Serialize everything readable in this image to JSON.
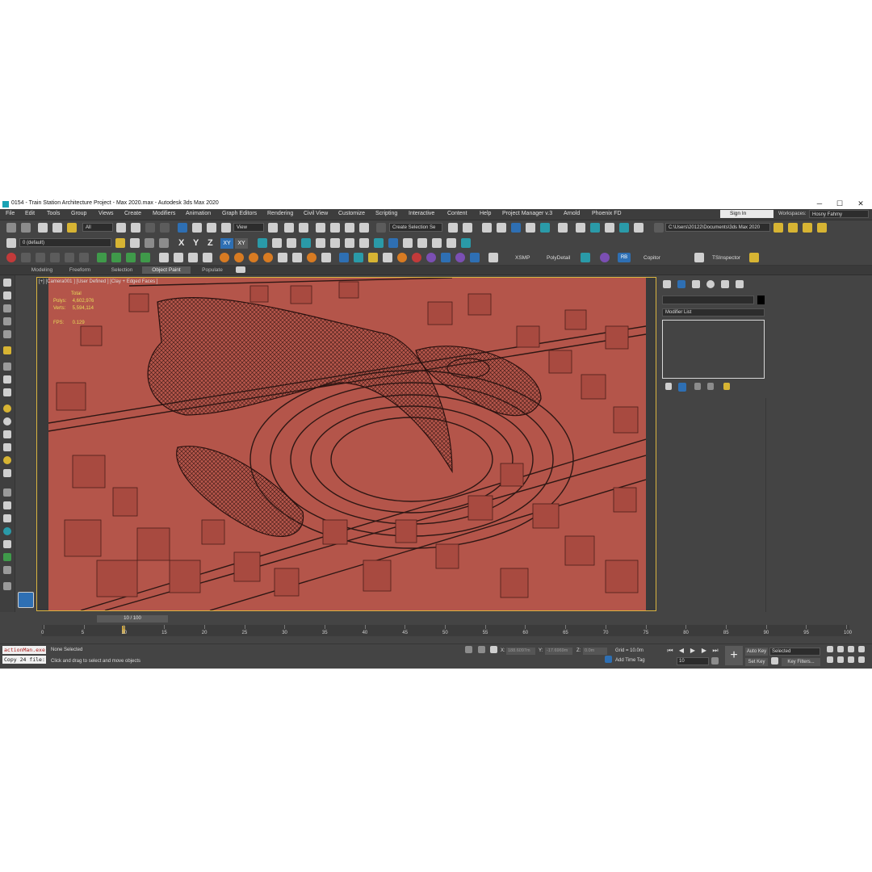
{
  "window": {
    "title": "0154 - Train Station Architecture Project - Max 2020.max - Autodesk 3ds Max 2020",
    "minimize": "─",
    "maximize": "☐",
    "close": "✕"
  },
  "menu": [
    "File",
    "Edit",
    "Tools",
    "Group",
    "Views",
    "Create",
    "Modifiers",
    "Animation",
    "Graph Editors",
    "Rendering",
    "Civil View",
    "Customize",
    "Scripting",
    "Interactive",
    "Content",
    "Help",
    "Project Manager v.3",
    "Arnold",
    "Phoenix FD"
  ],
  "account": {
    "sign_in": "Sign In",
    "workspaces_label": "Workspaces:",
    "workspace": "Hosny Fahmy"
  },
  "toolbar1": {
    "filter": "All",
    "ref_coord": "View",
    "selection_set": "Create Selection Se",
    "project_path": "C:\\Users\\20122\\Documents\\3ds Max 2020"
  },
  "toolbar2": {
    "layer": "0 (default)",
    "axis_x": "X",
    "axis_y": "Y",
    "axis_z": "Z",
    "axis_xy": "XY",
    "axis_xy2": "XY"
  },
  "toolbar3": {
    "xsmp": "XSMP",
    "polydetail": "PolyDetail",
    "rb": "RB",
    "copitor": "Copitor",
    "tsinspector": "TSInspector"
  },
  "ribbon_tabs": [
    "Modeling",
    "Freeform",
    "Selection",
    "Object Paint",
    "Populate"
  ],
  "viewport": {
    "label": "[+] [Camera001 ] [User Defined ] [Clay + Edged Faces ]",
    "stats": {
      "total_label": "Total",
      "polys_label": "Polys:",
      "polys": "4,602,976",
      "verts_label": "Verts:",
      "verts": "5,594,114",
      "fps_label": "FPS:",
      "fps": "0.129"
    }
  },
  "command_panel": {
    "modifier_list": "Modifier List"
  },
  "timeline": {
    "frame_indicator": "10 / 100",
    "ticks": [
      0,
      5,
      10,
      15,
      20,
      25,
      30,
      35,
      40,
      45,
      50,
      55,
      60,
      65,
      70,
      75,
      80,
      85,
      90,
      95,
      100
    ],
    "current_frame": 10
  },
  "status": {
    "script_line1": "actionMan.exe",
    "script_line2": "Copy 24 file:",
    "selection_status": "None Selected",
    "prompt": "Click and drag to select and move objects",
    "x_label": "X:",
    "x_value": "188.6097m",
    "y_label": "Y:",
    "y_value": "-17.6969m",
    "z_label": "Z:",
    "z_value": "0.0m",
    "grid": "Grid = 10.0m",
    "add_time_tag": "Add Time Tag",
    "auto_key": "Auto Key",
    "selected": "Selected",
    "set_key": "Set Key",
    "key_filters": "Key Filters...",
    "frame": "10"
  },
  "colors": {
    "viewport_bg": "#b4554a",
    "ui_bg": "#444444",
    "accent_blue": "#2e6fb3",
    "viewport_border": "#d9b441"
  }
}
